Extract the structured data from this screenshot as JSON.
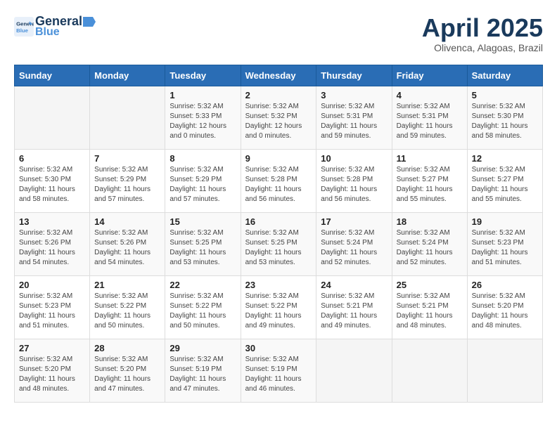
{
  "header": {
    "logo_line1": "General",
    "logo_line2": "Blue",
    "month": "April 2025",
    "location": "Olivenca, Alagoas, Brazil"
  },
  "weekdays": [
    "Sunday",
    "Monday",
    "Tuesday",
    "Wednesday",
    "Thursday",
    "Friday",
    "Saturday"
  ],
  "weeks": [
    [
      {
        "day": "",
        "info": ""
      },
      {
        "day": "",
        "info": ""
      },
      {
        "day": "1",
        "info": "Sunrise: 5:32 AM\nSunset: 5:33 PM\nDaylight: 12 hours\nand 0 minutes."
      },
      {
        "day": "2",
        "info": "Sunrise: 5:32 AM\nSunset: 5:32 PM\nDaylight: 12 hours\nand 0 minutes."
      },
      {
        "day": "3",
        "info": "Sunrise: 5:32 AM\nSunset: 5:31 PM\nDaylight: 11 hours\nand 59 minutes."
      },
      {
        "day": "4",
        "info": "Sunrise: 5:32 AM\nSunset: 5:31 PM\nDaylight: 11 hours\nand 59 minutes."
      },
      {
        "day": "5",
        "info": "Sunrise: 5:32 AM\nSunset: 5:30 PM\nDaylight: 11 hours\nand 58 minutes."
      }
    ],
    [
      {
        "day": "6",
        "info": "Sunrise: 5:32 AM\nSunset: 5:30 PM\nDaylight: 11 hours\nand 58 minutes."
      },
      {
        "day": "7",
        "info": "Sunrise: 5:32 AM\nSunset: 5:29 PM\nDaylight: 11 hours\nand 57 minutes."
      },
      {
        "day": "8",
        "info": "Sunrise: 5:32 AM\nSunset: 5:29 PM\nDaylight: 11 hours\nand 57 minutes."
      },
      {
        "day": "9",
        "info": "Sunrise: 5:32 AM\nSunset: 5:28 PM\nDaylight: 11 hours\nand 56 minutes."
      },
      {
        "day": "10",
        "info": "Sunrise: 5:32 AM\nSunset: 5:28 PM\nDaylight: 11 hours\nand 56 minutes."
      },
      {
        "day": "11",
        "info": "Sunrise: 5:32 AM\nSunset: 5:27 PM\nDaylight: 11 hours\nand 55 minutes."
      },
      {
        "day": "12",
        "info": "Sunrise: 5:32 AM\nSunset: 5:27 PM\nDaylight: 11 hours\nand 55 minutes."
      }
    ],
    [
      {
        "day": "13",
        "info": "Sunrise: 5:32 AM\nSunset: 5:26 PM\nDaylight: 11 hours\nand 54 minutes."
      },
      {
        "day": "14",
        "info": "Sunrise: 5:32 AM\nSunset: 5:26 PM\nDaylight: 11 hours\nand 54 minutes."
      },
      {
        "day": "15",
        "info": "Sunrise: 5:32 AM\nSunset: 5:25 PM\nDaylight: 11 hours\nand 53 minutes."
      },
      {
        "day": "16",
        "info": "Sunrise: 5:32 AM\nSunset: 5:25 PM\nDaylight: 11 hours\nand 53 minutes."
      },
      {
        "day": "17",
        "info": "Sunrise: 5:32 AM\nSunset: 5:24 PM\nDaylight: 11 hours\nand 52 minutes."
      },
      {
        "day": "18",
        "info": "Sunrise: 5:32 AM\nSunset: 5:24 PM\nDaylight: 11 hours\nand 52 minutes."
      },
      {
        "day": "19",
        "info": "Sunrise: 5:32 AM\nSunset: 5:23 PM\nDaylight: 11 hours\nand 51 minutes."
      }
    ],
    [
      {
        "day": "20",
        "info": "Sunrise: 5:32 AM\nSunset: 5:23 PM\nDaylight: 11 hours\nand 51 minutes."
      },
      {
        "day": "21",
        "info": "Sunrise: 5:32 AM\nSunset: 5:22 PM\nDaylight: 11 hours\nand 50 minutes."
      },
      {
        "day": "22",
        "info": "Sunrise: 5:32 AM\nSunset: 5:22 PM\nDaylight: 11 hours\nand 50 minutes."
      },
      {
        "day": "23",
        "info": "Sunrise: 5:32 AM\nSunset: 5:22 PM\nDaylight: 11 hours\nand 49 minutes."
      },
      {
        "day": "24",
        "info": "Sunrise: 5:32 AM\nSunset: 5:21 PM\nDaylight: 11 hours\nand 49 minutes."
      },
      {
        "day": "25",
        "info": "Sunrise: 5:32 AM\nSunset: 5:21 PM\nDaylight: 11 hours\nand 48 minutes."
      },
      {
        "day": "26",
        "info": "Sunrise: 5:32 AM\nSunset: 5:20 PM\nDaylight: 11 hours\nand 48 minutes."
      }
    ],
    [
      {
        "day": "27",
        "info": "Sunrise: 5:32 AM\nSunset: 5:20 PM\nDaylight: 11 hours\nand 48 minutes."
      },
      {
        "day": "28",
        "info": "Sunrise: 5:32 AM\nSunset: 5:20 PM\nDaylight: 11 hours\nand 47 minutes."
      },
      {
        "day": "29",
        "info": "Sunrise: 5:32 AM\nSunset: 5:19 PM\nDaylight: 11 hours\nand 47 minutes."
      },
      {
        "day": "30",
        "info": "Sunrise: 5:32 AM\nSunset: 5:19 PM\nDaylight: 11 hours\nand 46 minutes."
      },
      {
        "day": "",
        "info": ""
      },
      {
        "day": "",
        "info": ""
      },
      {
        "day": "",
        "info": ""
      }
    ]
  ]
}
